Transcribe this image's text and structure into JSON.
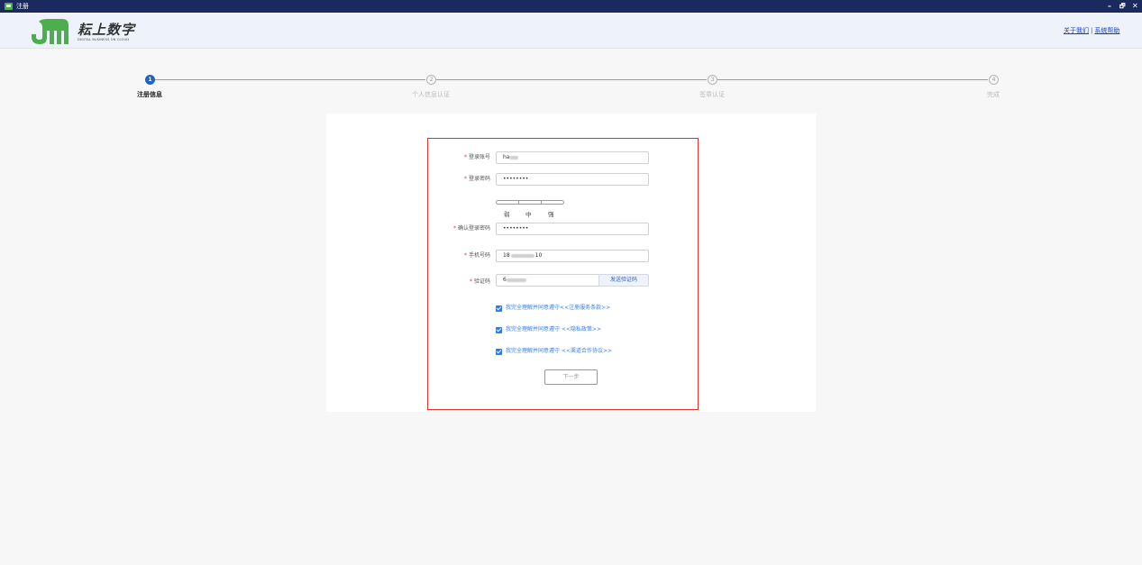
{
  "window": {
    "title": "注册",
    "controls": {
      "minimize": "–",
      "maximize": "🗗",
      "close": "✕"
    }
  },
  "header": {
    "logo_text": "耘上数字",
    "logo_subtext": "DIGITAL BUSINESS ON CLOUD",
    "links": {
      "about": "关于我们",
      "separator": "|",
      "help": "系统帮助"
    }
  },
  "steps": [
    {
      "number": "1",
      "label": "注册信息",
      "state": "active"
    },
    {
      "number": "2",
      "label": "个人信息认证",
      "state": "inactive"
    },
    {
      "number": "3",
      "label": "签章认证",
      "state": "inactive"
    },
    {
      "number": "4",
      "label": "完成",
      "state": "inactive"
    }
  ],
  "form": {
    "required_mark": "*",
    "account": {
      "label": "登录账号",
      "value": "ha"
    },
    "password": {
      "label": "登录密码",
      "value": "••••••••"
    },
    "strength": {
      "weak": "弱",
      "medium": "中",
      "strong": "强"
    },
    "confirm_password": {
      "label": "确认登录密码",
      "value": "••••••••"
    },
    "phone": {
      "label": "手机号码",
      "value_prefix": "18",
      "value_suffix": "10"
    },
    "code": {
      "label": "验证码",
      "value": "6",
      "send_label": "发送验证码"
    },
    "agreements": [
      {
        "text": "我完全理解并同意遵守",
        "link": "<<注册服务条款>>",
        "checked": true
      },
      {
        "text": "我完全理解并同意遵守",
        "link": " <<隐私政策>>",
        "checked": true
      },
      {
        "text": "我完全理解并同意遵守",
        "link": " <<渠道合作协议>>",
        "checked": true
      }
    ],
    "next_label": "下一步"
  },
  "colors": {
    "titlebar": "#1b2a5e",
    "accent": "#1f63c6",
    "required": "#e0352b",
    "logo_green": "#4cae4c"
  }
}
